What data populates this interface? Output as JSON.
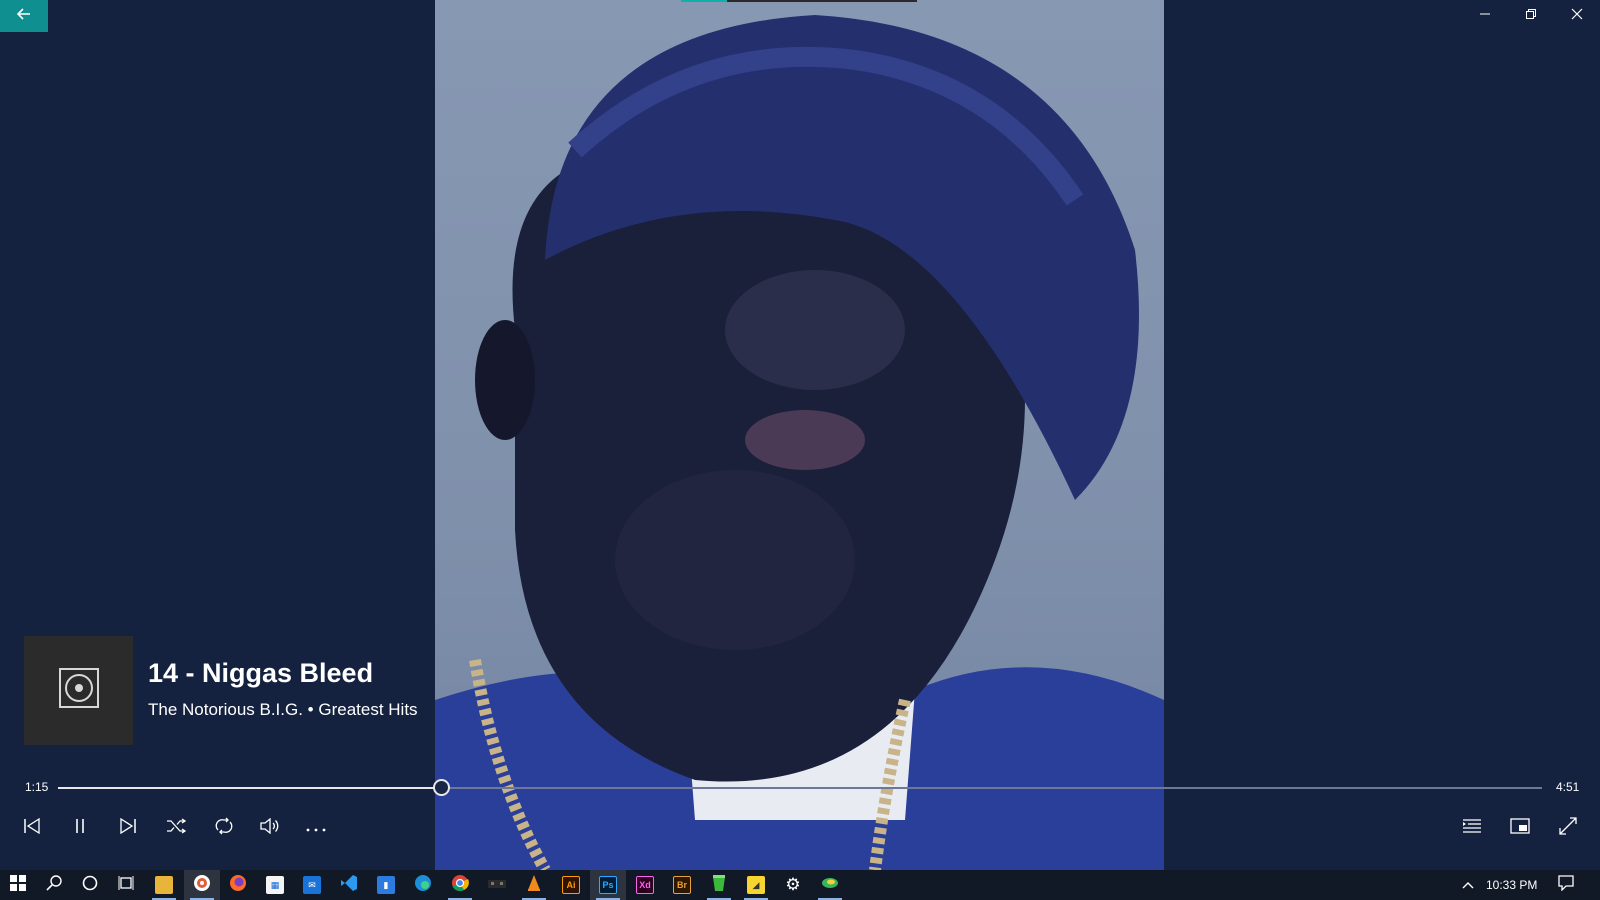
{
  "now_playing": {
    "title": "14 - Niggas Bleed",
    "subtitle": "The Notorious B.I.G. • Greatest Hits",
    "artist": "The Notorious B.I.G.",
    "album": "Greatest Hits",
    "album_icon": "music-disc-icon"
  },
  "progress": {
    "elapsed": "1:15",
    "total": "4:51",
    "fraction": 0.258
  },
  "window_controls": [
    "minimize-icon",
    "restore-icon",
    "close-icon"
  ],
  "controls_left": [
    "previous-icon",
    "pause-icon",
    "next-icon",
    "shuffle-icon",
    "repeat-icon",
    "volume-icon",
    "more-icon"
  ],
  "controls_right": [
    "now-playing-list-icon",
    "mini-player-icon",
    "full-screen-icon"
  ],
  "taskbar": {
    "clock": "10:33 PM",
    "apps": [
      "start",
      "search",
      "cortana",
      "task-view",
      "file-explorer",
      "groove-music",
      "firefox",
      "microsoft-store",
      "mail",
      "vscode",
      "app-blue",
      "edge",
      "chrome",
      "pixel-app",
      "vlc",
      "illustrator",
      "photoshop",
      "xd",
      "bridge",
      "green-app",
      "sticky-notes",
      "settings",
      "snip-app"
    ]
  },
  "colors": {
    "accent": "#0f8f8f",
    "background": "#142240",
    "taskbar": "#111826"
  }
}
